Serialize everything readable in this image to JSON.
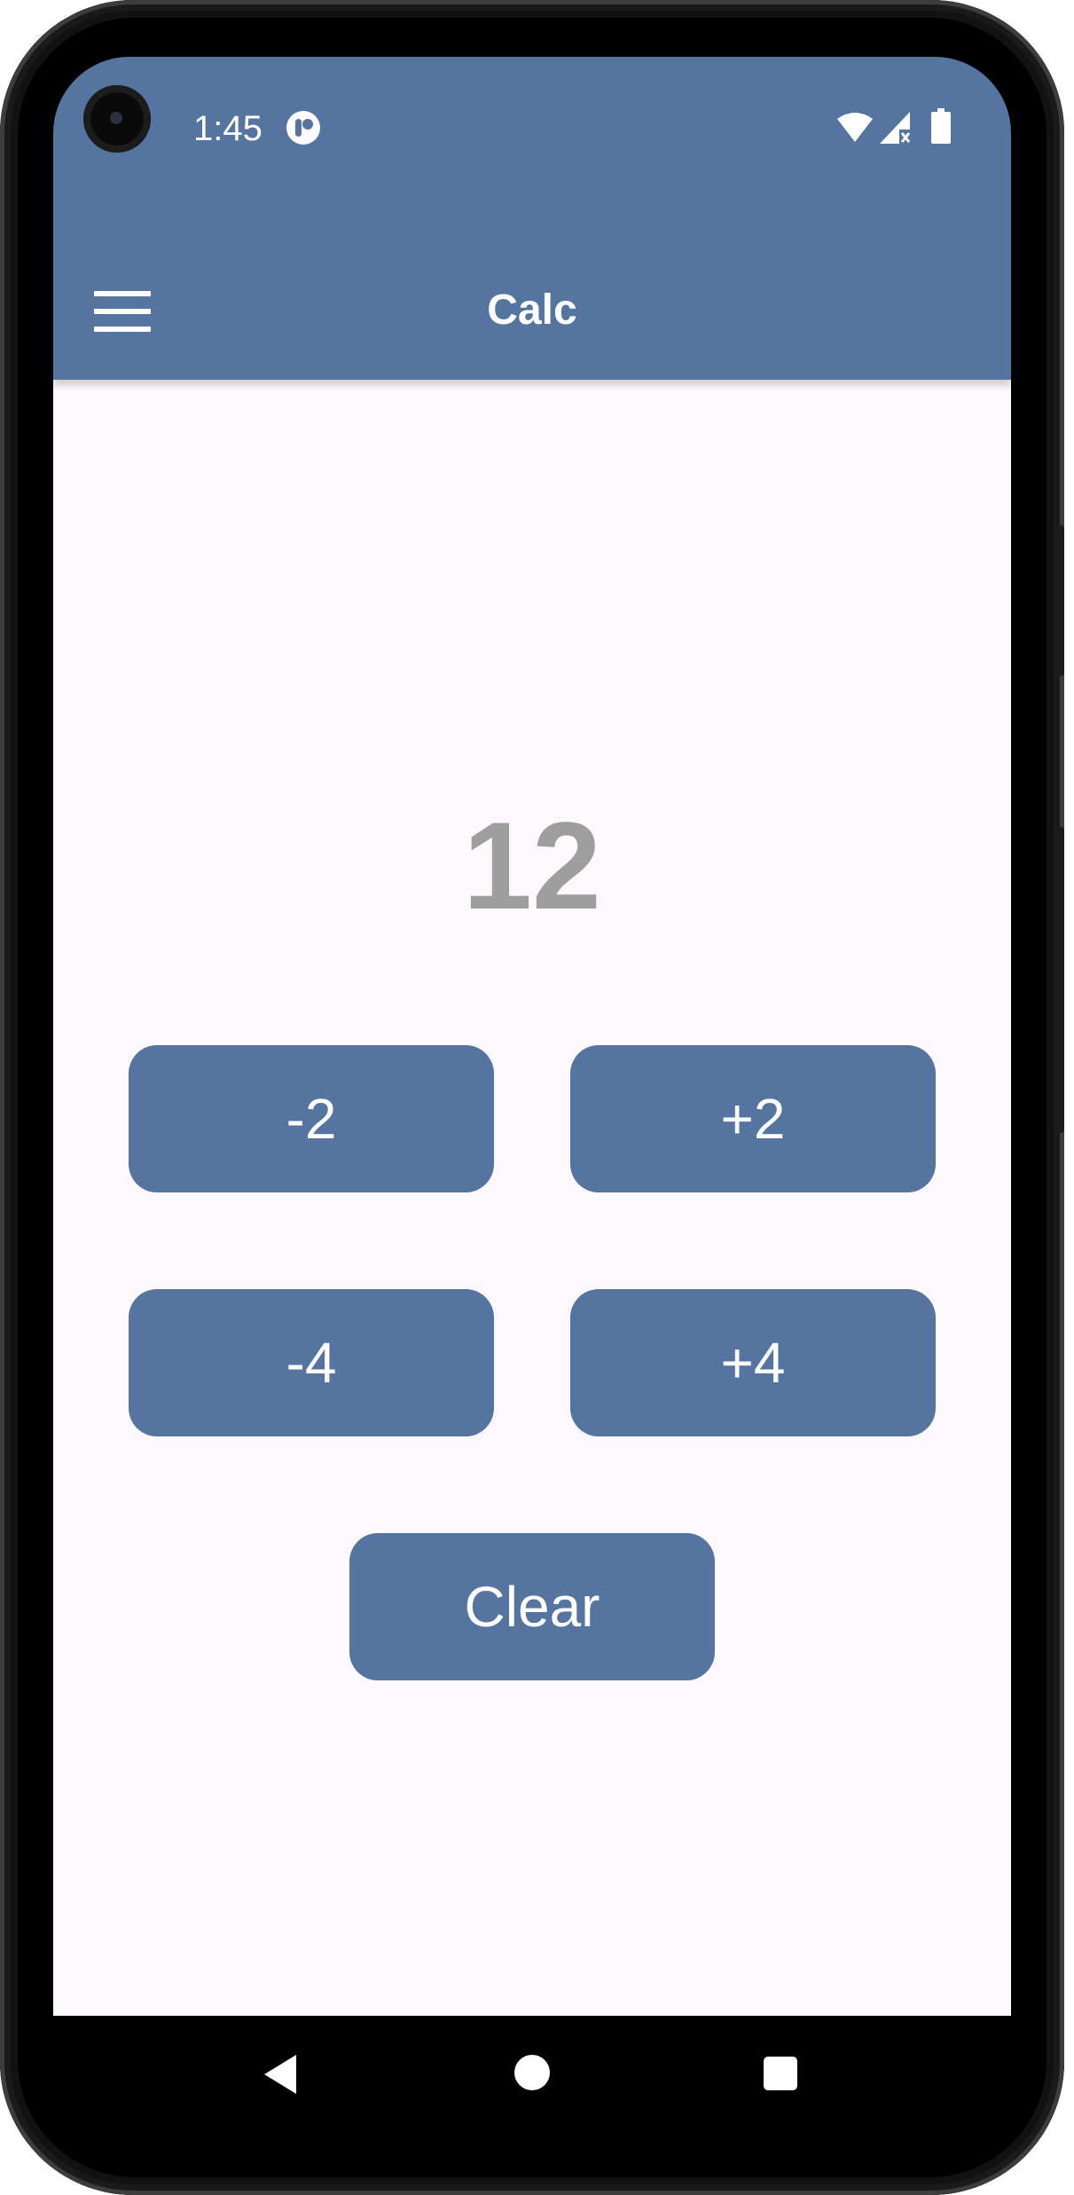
{
  "status_bar": {
    "time": "1:45",
    "icons": [
      "app-notification-icon",
      "wifi-icon",
      "signal-icon",
      "battery-icon"
    ]
  },
  "app_bar": {
    "title": "Calc",
    "menu_icon": "menu-icon"
  },
  "display": {
    "value": "12"
  },
  "buttons": {
    "minus2": "-2",
    "plus2": "+2",
    "minus4": "-4",
    "plus4": "+4",
    "clear": "Clear"
  },
  "nav_bar": {
    "icons": [
      "back-icon",
      "home-icon",
      "recents-icon"
    ]
  },
  "colors": {
    "primary": "#55749f",
    "background": "#fdf8fc",
    "display_text": "#9e9e9e",
    "on_primary": "#ffffff"
  }
}
